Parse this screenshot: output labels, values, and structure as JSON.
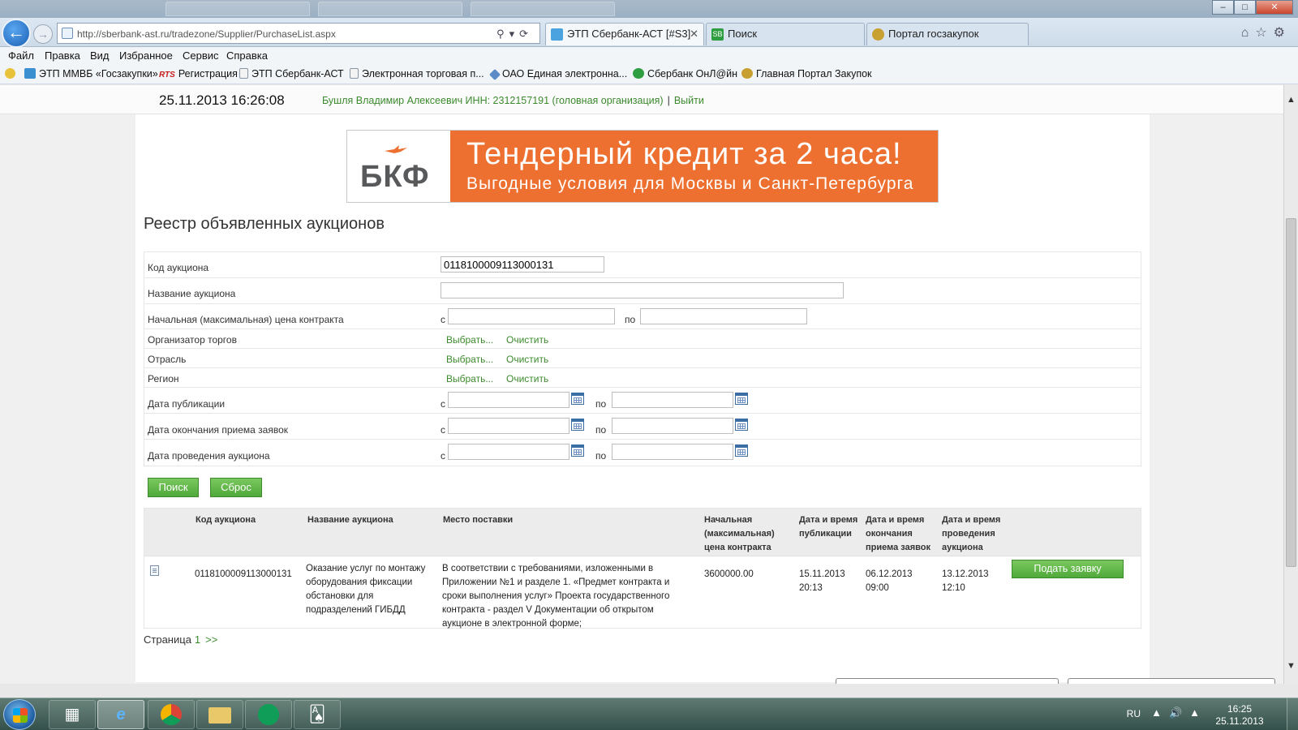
{
  "browser": {
    "address_url": "http://sberbank-ast.ru/tradezone/Supplier/PurchaseList.aspx",
    "tabs": [
      {
        "label": "ЭТП Сбербанк-АСТ [#S3]",
        "active": true
      },
      {
        "label": "Поиск",
        "active": false
      },
      {
        "label": "Портал госзакупок",
        "active": false
      }
    ],
    "window_buttons": {
      "minimize": "–",
      "maximize": "□",
      "close": "✕"
    }
  },
  "menu": [
    "Файл",
    "Правка",
    "Вид",
    "Избранное",
    "Сервис",
    "Справка"
  ],
  "favorites": [
    "ЭТП ММВБ «Госзакупки»",
    "Регистрация",
    "ЭТП Сбербанк-АСТ",
    "Электронная торговая п...",
    "ОАО Единая электронна...",
    "Сбербанк ОнЛ@йн",
    "Главная Портал Закупок"
  ],
  "topbar": {
    "datetime": "25.11.2013  16:26:08",
    "user": "Бушля Владимир Алексеевич ИНН: 2312157191 (головная организация)",
    "separator": "|",
    "logout": "Выйти"
  },
  "banner": {
    "logo_text": "БКФ",
    "title": "Тендерный кредит за 2 часа!",
    "subtitle": "Выгодные условия для Москвы и Санкт-Петербурга",
    "bg_color": "#ed7030"
  },
  "page_title": "Реестр объявленных аукционов",
  "filter": {
    "auction_code_label": "Код аукциона",
    "auction_code_value": "0118100009113000131",
    "auction_name_label": "Название аукциона",
    "auction_name_value": "",
    "price_label": "Начальная (максимальная) цена контракта",
    "from": "с",
    "to": "по",
    "organizer_label": "Организатор торгов",
    "industry_label": "Отрасль",
    "region_label": "Регион",
    "select_link": "Выбрать...",
    "clear_link": "Очистить",
    "pub_date_label": "Дата публикации",
    "end_date_label": "Дата окончания приема заявок",
    "auction_date_label": "Дата проведения аукциона"
  },
  "buttons": {
    "search": "Поиск",
    "reset": "Сброс"
  },
  "results": {
    "headers": {
      "code": "Код аукциона",
      "name": "Название аукциона",
      "place": "Место поставки",
      "price": "Начальная (максимальная) цена контракта",
      "pub": "Дата и время публикации",
      "end": "Дата и время окончания приема заявок",
      "held": "Дата и время проведения аукциона"
    },
    "rows": [
      {
        "code": "0118100009113000131",
        "name": "Оказание услуг по монтажу оборудования фиксации обстановки для подразделений ГИБДД",
        "place": "В соответствии с требованиями, изложенными в Приложении №1 и разделе 1. «Предмет контракта и сроки выполнения услуг» Проекта государственного контракта - раздел V Документации об открытом аукционе в электронной форме;",
        "price": "3600000.00",
        "pub_date": "15.11.2013",
        "pub_time": "20:13",
        "end_date": "06.12.2013",
        "end_time": "09:00",
        "held_date": "13.12.2013",
        "held_time": "12:10",
        "action": "Подать заявку"
      }
    ]
  },
  "pager": {
    "label": "Страница",
    "current": "1",
    "next": ">>"
  },
  "taskbar": {
    "language": "RU",
    "time": "16:25",
    "date": "25.11.2013"
  },
  "colors": {
    "accent_green": "#3c8a2e",
    "button_green": "#4fa93a"
  }
}
